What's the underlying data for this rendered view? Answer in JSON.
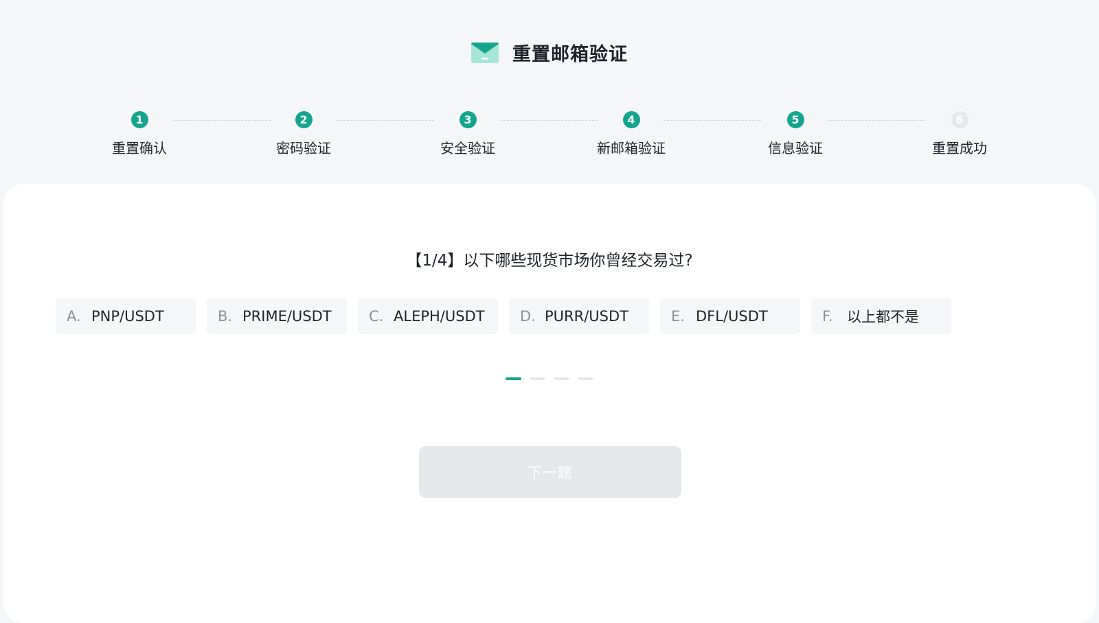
{
  "header": {
    "title": "重置邮箱验证",
    "icon": "mail-icon"
  },
  "steps": [
    {
      "number": "1",
      "label": "重置确认",
      "state": "done"
    },
    {
      "number": "2",
      "label": "密码验证",
      "state": "done"
    },
    {
      "number": "3",
      "label": "安全验证",
      "state": "done"
    },
    {
      "number": "4",
      "label": "新邮箱验证",
      "state": "done"
    },
    {
      "number": "5",
      "label": "信息验证",
      "state": "current"
    },
    {
      "number": "6",
      "label": "重置成功",
      "state": "pending"
    }
  ],
  "quiz": {
    "question": "【1/4】以下哪些现货市场你曾经交易过?",
    "options": [
      {
        "letter": "A.",
        "text": "PNP/USDT"
      },
      {
        "letter": "B.",
        "text": "PRIME/USDT"
      },
      {
        "letter": "C.",
        "text": "ALEPH/USDT"
      },
      {
        "letter": "D.",
        "text": "PURR/USDT"
      },
      {
        "letter": "E.",
        "text": "DFL/USDT"
      },
      {
        "letter": "F.",
        "text": "以上都不是"
      }
    ],
    "pager": {
      "current": 1,
      "total": 4
    },
    "next_label": "下一题"
  },
  "colors": {
    "accent": "#14a58c",
    "background": "#f5f6f8",
    "card": "#ffffff",
    "disabled_button": "#e6e7ea"
  }
}
